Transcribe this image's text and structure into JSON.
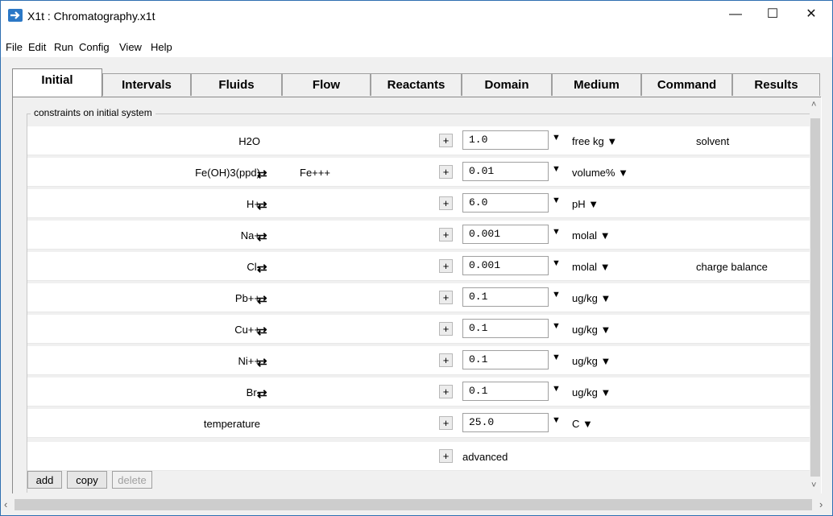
{
  "window": {
    "title": "X1t : Chromatography.x1t",
    "minimize": "—",
    "maximize": "☐",
    "close": "✕"
  },
  "menu": [
    "File",
    "Edit",
    "Run",
    "Config",
    "View",
    "Help"
  ],
  "tabs": [
    "Initial",
    "Intervals",
    "Fluids",
    "Flow",
    "Reactants",
    "Domain",
    "Medium",
    "Command",
    "Results"
  ],
  "active_tab": "Initial",
  "group_label": "constraints on initial system",
  "rows": [
    {
      "species": "H2O",
      "swap": "",
      "swapped": "",
      "value": "1.0",
      "unit": "free kg",
      "comment": "solvent"
    },
    {
      "species": "Fe(OH)3(ppd)",
      "swap": "⇄",
      "swapped": "Fe+++",
      "value": "0.01",
      "unit": "volume%",
      "comment": ""
    },
    {
      "species": "H+",
      "swap": "⇄",
      "swapped": "",
      "value": "6.0",
      "unit": "pH",
      "comment": ""
    },
    {
      "species": "Na+",
      "swap": "⇄",
      "swapped": "",
      "value": "0.001",
      "unit": "molal",
      "comment": ""
    },
    {
      "species": "Cl-",
      "swap": "⇄",
      "swapped": "",
      "value": "0.001",
      "unit": "molal",
      "comment": "charge balance"
    },
    {
      "species": "Pb++",
      "swap": "⇄",
      "swapped": "",
      "value": "0.1",
      "unit": "ug/kg",
      "comment": ""
    },
    {
      "species": "Cu++",
      "swap": "⇄",
      "swapped": "",
      "value": "0.1",
      "unit": "ug/kg",
      "comment": ""
    },
    {
      "species": "Ni++",
      "swap": "⇄",
      "swapped": "",
      "value": "0.1",
      "unit": "ug/kg",
      "comment": ""
    },
    {
      "species": "Br-",
      "swap": "⇄",
      "swapped": "",
      "value": "0.1",
      "unit": "ug/kg",
      "comment": ""
    },
    {
      "species": "temperature",
      "swap": "",
      "swapped": "",
      "value": "25.0",
      "unit": "C",
      "comment": ""
    }
  ],
  "advanced_label": "advanced",
  "plus_label": "+",
  "dropdown_arrow": "▼",
  "buttons": {
    "add": "add",
    "copy": "copy",
    "delete": "delete"
  },
  "colors": {
    "accent": "#2b78c6",
    "tab_active_bg": "#ffffff",
    "panel_bg": "#f0f0f0"
  }
}
